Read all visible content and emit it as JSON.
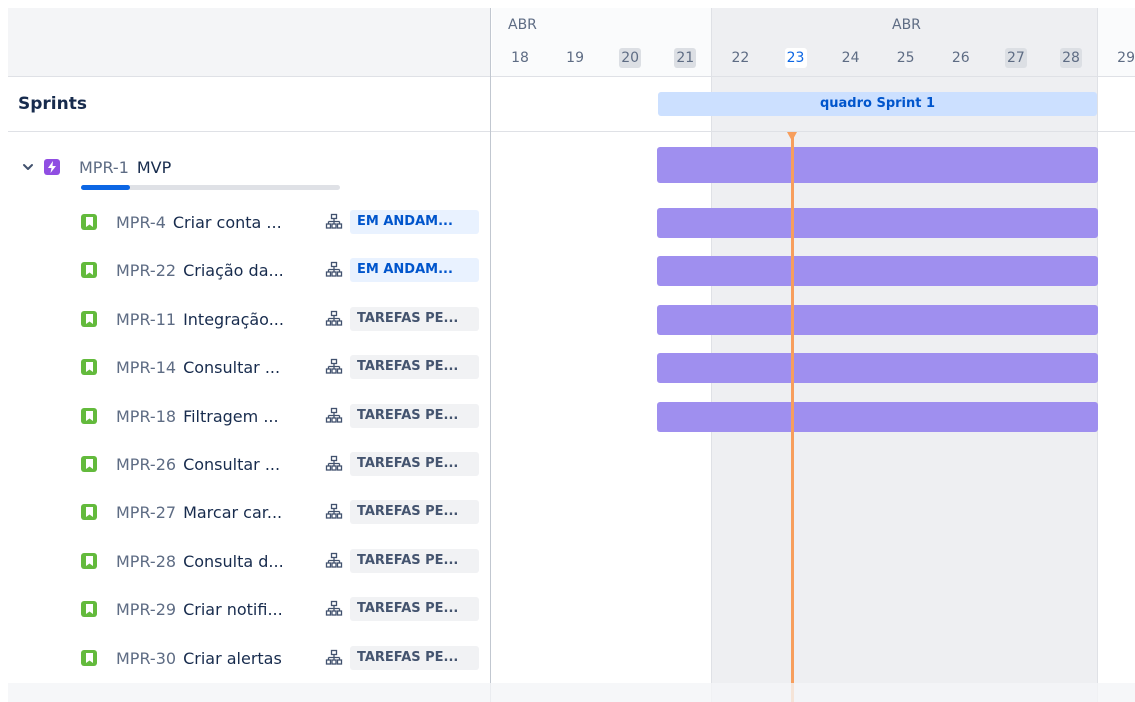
{
  "timeline": {
    "months": [
      {
        "label": "ABR",
        "pos": "first"
      },
      {
        "label": "ABR",
        "pos": "second"
      }
    ],
    "days": [
      {
        "label": "18",
        "weekend": false,
        "today": false
      },
      {
        "label": "19",
        "weekend": false,
        "today": false
      },
      {
        "label": "20",
        "weekend": true,
        "today": false
      },
      {
        "label": "21",
        "weekend": true,
        "today": false
      },
      {
        "label": "22",
        "weekend": false,
        "today": false
      },
      {
        "label": "23",
        "weekend": false,
        "today": true
      },
      {
        "label": "24",
        "weekend": false,
        "today": false
      },
      {
        "label": "25",
        "weekend": false,
        "today": false
      },
      {
        "label": "26",
        "weekend": false,
        "today": false
      },
      {
        "label": "27",
        "weekend": true,
        "today": false
      },
      {
        "label": "28",
        "weekend": true,
        "today": false
      },
      {
        "label": "29",
        "weekend": false,
        "today": false
      }
    ],
    "sprint_label": "quadro Sprint 1"
  },
  "sprints": {
    "title": "Sprints"
  },
  "epic": {
    "key": "MPR-1",
    "name": "MVP",
    "progress": 0.19
  },
  "issues": [
    {
      "key": "MPR-4",
      "summary": "Criar conta ...",
      "status": "EM ANDAM...",
      "status_color": "blue",
      "has_bar": true
    },
    {
      "key": "MPR-22",
      "summary": "Criação da...",
      "status": "EM ANDAM...",
      "status_color": "blue",
      "has_bar": true
    },
    {
      "key": "MPR-11",
      "summary": "Integração...",
      "status": "TAREFAS PE...",
      "status_color": "gray",
      "has_bar": true
    },
    {
      "key": "MPR-14",
      "summary": "Consultar ...",
      "status": "TAREFAS PE...",
      "status_color": "gray",
      "has_bar": true
    },
    {
      "key": "MPR-18",
      "summary": "Filtragem ...",
      "status": "TAREFAS PE...",
      "status_color": "gray",
      "has_bar": true
    },
    {
      "key": "MPR-26",
      "summary": "Consultar ...",
      "status": "TAREFAS PE...",
      "status_color": "gray",
      "has_bar": false
    },
    {
      "key": "MPR-27",
      "summary": "Marcar car...",
      "status": "TAREFAS PE...",
      "status_color": "gray",
      "has_bar": false
    },
    {
      "key": "MPR-28",
      "summary": "Consulta d...",
      "status": "TAREFAS PE...",
      "status_color": "gray",
      "has_bar": false
    },
    {
      "key": "MPR-29",
      "summary": "Criar notifi...",
      "status": "TAREFAS PE...",
      "status_color": "gray",
      "has_bar": false
    },
    {
      "key": "MPR-30",
      "summary": "Criar alertas",
      "status": "TAREFAS PE...",
      "status_color": "gray",
      "has_bar": false
    }
  ],
  "icons": {
    "expand": "chevron-down-icon",
    "epic": "epic-lightning-icon",
    "story": "story-bookmark-icon",
    "hierarchy": "child-issues-icon"
  },
  "colors": {
    "epic_bar": "#9f8fef",
    "sprint_bar": "#cce0ff",
    "today_line": "#f79e5d",
    "story": "#63ba3c",
    "epic": "#904ee2"
  }
}
